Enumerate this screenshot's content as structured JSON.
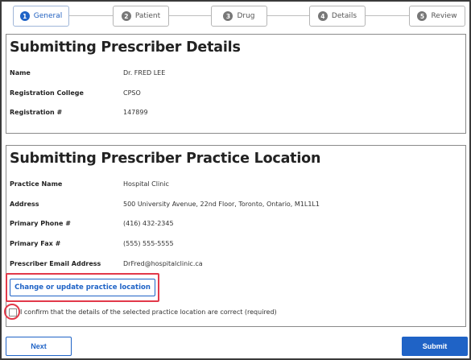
{
  "stepper": {
    "steps": [
      {
        "num": "1",
        "label": "General"
      },
      {
        "num": "2",
        "label": "Patient"
      },
      {
        "num": "3",
        "label": "Drug"
      },
      {
        "num": "4",
        "label": "Details"
      },
      {
        "num": "5",
        "label": "Review"
      }
    ],
    "active_index": 0
  },
  "prescriber": {
    "title": "Submitting Prescriber Details",
    "fields": [
      {
        "label": "Name",
        "value": "Dr. FRED LEE"
      },
      {
        "label": "Registration College",
        "value": "CPSO"
      },
      {
        "label": "Registration #",
        "value": "147899"
      }
    ]
  },
  "location": {
    "title": "Submitting Prescriber Practice Location",
    "fields": [
      {
        "label": "Practice Name",
        "value": "Hospital Clinic"
      },
      {
        "label": "Address",
        "value": "500 University Avenue, 22nd Floor, Toronto, Ontario, M1L1L1"
      },
      {
        "label": "Primary Phone #",
        "value": "(416) 432-2345"
      },
      {
        "label": "Primary Fax #",
        "value": "(555) 555-5555"
      },
      {
        "label": "Prescriber Email Address",
        "value": "DrFred@hospitalclinic.ca"
      }
    ],
    "change_button": "Change or update practice location",
    "confirm_text": "I confirm that the details of the selected practice location are correct  (required)"
  },
  "footer": {
    "next_label": "Next",
    "submit_label": "Submit"
  },
  "colors": {
    "accent": "#1f63c6",
    "highlight": "#e2394a"
  }
}
